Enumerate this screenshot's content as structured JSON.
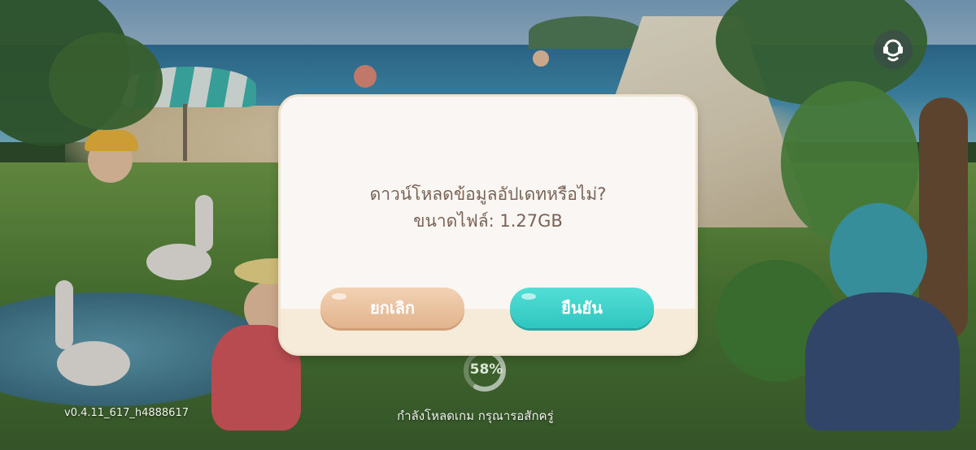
{
  "dialog": {
    "message_line1": "ดาวน์โหลดข้อมูลอัปเดทหรือไม่?",
    "message_line2": "ขนาดไฟล์: 1.27GB",
    "cancel_label": "ยกเลิก",
    "confirm_label": "ยืนยัน"
  },
  "loading": {
    "progress_text": "58%",
    "progress_value": 0.58,
    "status_text": "กำลังโหลดเกม กรุณารอสักครู่"
  },
  "version": "v0.4.11_617_h4888617",
  "icons": {
    "support": "headset-support-icon"
  },
  "colors": {
    "confirm": "#2ec6c0",
    "cancel": "#e2b48d",
    "message_text": "#7a6355"
  }
}
